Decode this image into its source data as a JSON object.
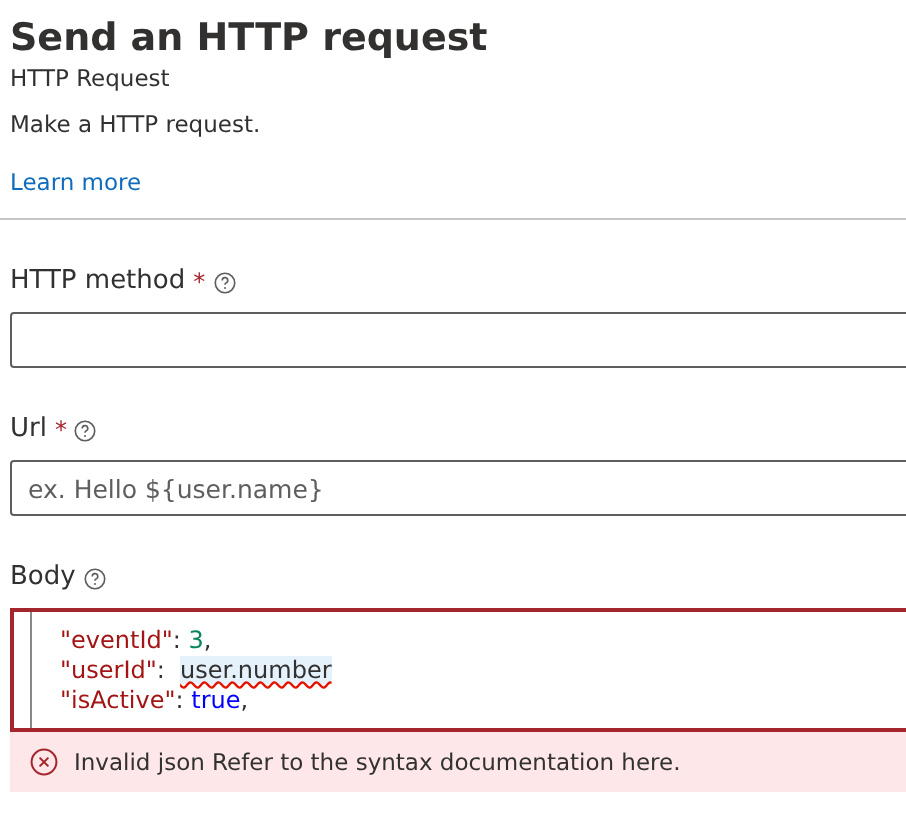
{
  "panel": {
    "title": "Send an HTTP request",
    "subtitle": "HTTP Request",
    "description": "Make a HTTP request.",
    "link": "Learn more"
  },
  "fields": [
    {
      "kind": "input",
      "label": "HTTP method",
      "required_mark": "*",
      "help": true
    },
    {
      "kind": "input",
      "label": "Url",
      "required_mark": "*",
      "help": true,
      "placeholder": "ex. Hello ${user.name}"
    },
    {
      "kind": "code",
      "label": "Body",
      "help": true,
      "invalid": true,
      "lines": [
        [
          {
            "kind": "key",
            "text": "\"eventId\""
          },
          {
            "kind": "plain",
            "text": ": "
          },
          {
            "kind": "number",
            "text": "3"
          },
          {
            "kind": "plain",
            "text": ","
          }
        ],
        [
          {
            "kind": "key",
            "text": "\"userId\""
          },
          {
            "kind": "plain",
            "text": ":  "
          },
          {
            "kind": "error",
            "text": "user.number"
          }
        ],
        [
          {
            "kind": "key",
            "text": "\"isActive\""
          },
          {
            "kind": "plain",
            "text": ": "
          },
          {
            "kind": "bool",
            "text": "true"
          },
          {
            "kind": "plain",
            "text": ","
          }
        ]
      ],
      "error": "Invalid json Refer to the syntax documentation here."
    }
  ]
}
